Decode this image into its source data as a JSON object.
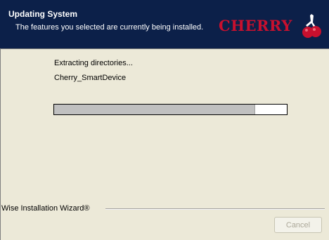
{
  "header": {
    "title": "Updating System",
    "subtitle": "The features you selected are currently being installed.",
    "logo_text": "CHERRY",
    "logo_color": "#c8102e",
    "background": "#0c2049"
  },
  "main": {
    "status_lines": [
      "Extracting directories...",
      "Cherry_SmartDevice"
    ],
    "progress": 0.86
  },
  "footer": {
    "wizard_label": "Wise Installation Wizard®",
    "cancel_label": "Cancel"
  }
}
